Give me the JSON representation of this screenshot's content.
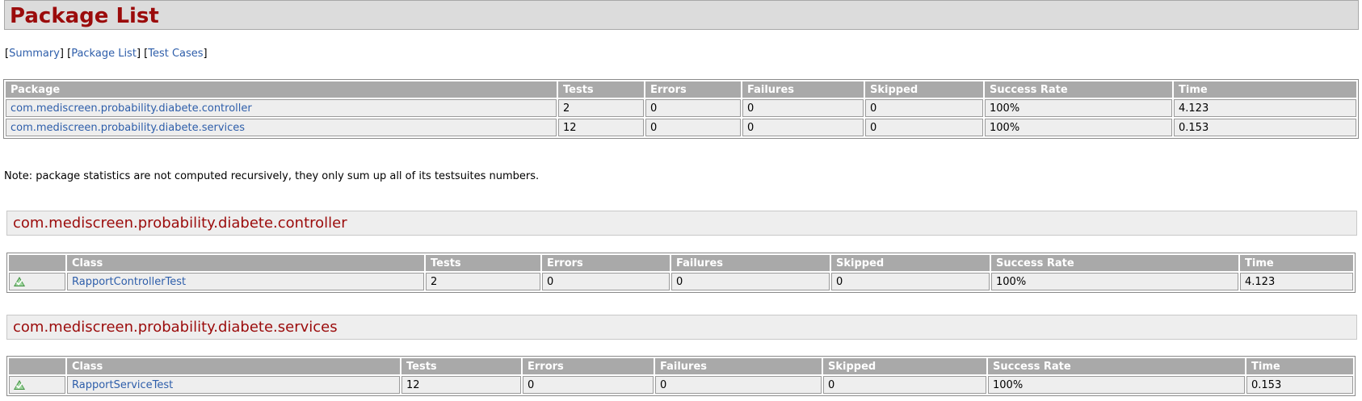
{
  "header": {
    "title": "Package List"
  },
  "nav": [
    {
      "label": "Summary"
    },
    {
      "label": "Package List"
    },
    {
      "label": "Test Cases"
    }
  ],
  "package_table": {
    "headers": [
      "Package",
      "Tests",
      "Errors",
      "Failures",
      "Skipped",
      "Success Rate",
      "Time"
    ],
    "rows": [
      {
        "package": "com.mediscreen.probability.diabete.controller",
        "tests": "2",
        "errors": "0",
        "failures": "0",
        "skipped": "0",
        "success_rate": "100%",
        "time": "4.123"
      },
      {
        "package": "com.mediscreen.probability.diabete.services",
        "tests": "12",
        "errors": "0",
        "failures": "0",
        "skipped": "0",
        "success_rate": "100%",
        "time": "0.153"
      }
    ]
  },
  "note": "Note: package statistics are not computed recursively, they only sum up all of its testsuites numbers.",
  "sections": [
    {
      "title": "com.mediscreen.probability.diabete.controller",
      "headers": [
        "",
        "Class",
        "Tests",
        "Errors",
        "Failures",
        "Skipped",
        "Success Rate",
        "Time"
      ],
      "row": {
        "icon": "pass-icon",
        "class_name": "RapportControllerTest",
        "tests": "2",
        "errors": "0",
        "failures": "0",
        "skipped": "0",
        "success_rate": "100%",
        "time": "4.123"
      }
    },
    {
      "title": "com.mediscreen.probability.diabete.services",
      "headers": [
        "",
        "Class",
        "Tests",
        "Errors",
        "Failures",
        "Skipped",
        "Success Rate",
        "Time"
      ],
      "row": {
        "icon": "pass-icon",
        "class_name": "RapportServiceTest",
        "tests": "12",
        "errors": "0",
        "failures": "0",
        "skipped": "0",
        "success_rate": "100%",
        "time": "0.153"
      }
    }
  ],
  "colors": {
    "title_red": "#9b0b0b",
    "link_blue": "#2e5eaa",
    "header_gray": "#a9a9a9",
    "cell_gray": "#eeeeee"
  }
}
